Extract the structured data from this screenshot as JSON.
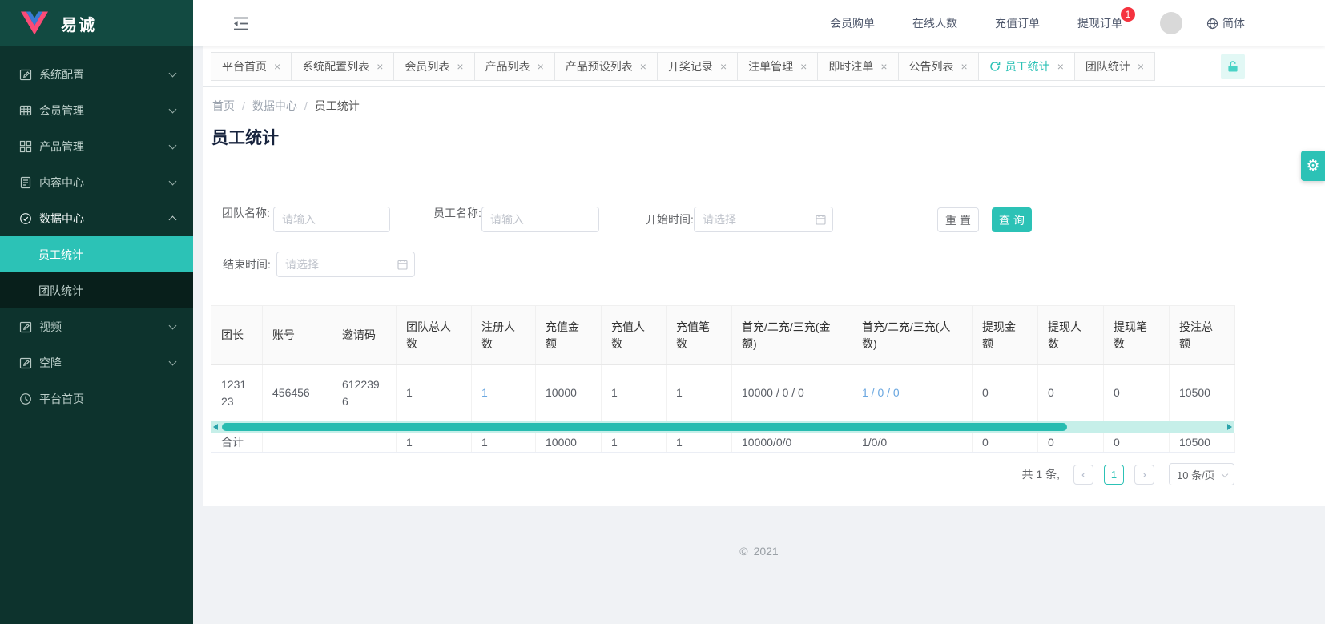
{
  "brand": {
    "name": "易诚"
  },
  "colors": {
    "accent": "#2cc2b6",
    "badge_red": "#f5333f",
    "link_blue": "#6aa7e0",
    "sidebar_bg": "#0d332d"
  },
  "sidebar": {
    "items": [
      {
        "label": "系统配置",
        "icon": "edit-icon"
      },
      {
        "label": "会员管理",
        "icon": "table-icon"
      },
      {
        "label": "产品管理",
        "icon": "grid-icon"
      },
      {
        "label": "内容中心",
        "icon": "document-icon"
      },
      {
        "label": "数据中心",
        "icon": "check-circle-icon",
        "children": [
          {
            "label": "员工统计",
            "active": true
          },
          {
            "label": "团队统计"
          }
        ]
      },
      {
        "label": "视频",
        "icon": "edit-icon"
      },
      {
        "label": "空降",
        "icon": "edit-icon"
      },
      {
        "label": "平台首页",
        "icon": "dashboard-icon"
      }
    ]
  },
  "topbar": {
    "menu": [
      {
        "label": "会员购单"
      },
      {
        "label": "在线人数"
      },
      {
        "label": "充值订单"
      },
      {
        "label": "提现订单",
        "badge": "1"
      }
    ],
    "language": "简体"
  },
  "tabs": {
    "close_symbol": "×",
    "items": [
      {
        "label": "平台首页"
      },
      {
        "label": "系统配置列表"
      },
      {
        "label": "会员列表"
      },
      {
        "label": "产品列表"
      },
      {
        "label": "产品预设列表"
      },
      {
        "label": "开奖记录"
      },
      {
        "label": "注单管理"
      },
      {
        "label": "即时注单"
      },
      {
        "label": "公告列表"
      },
      {
        "label": "员工统计",
        "active": true
      },
      {
        "label": "团队统计"
      }
    ]
  },
  "breadcrumb": {
    "separator": "/",
    "items": [
      {
        "label": "首页"
      },
      {
        "label": "数据中心"
      },
      {
        "label": "员工统计"
      }
    ]
  },
  "page": {
    "title": "员工统计"
  },
  "filters": {
    "team_name": {
      "label": "团队名称:",
      "placeholder": "请输入",
      "value": ""
    },
    "staff_name": {
      "label": "员工名称:",
      "placeholder": "请输入",
      "value": ""
    },
    "start_time": {
      "label": "开始时间:",
      "placeholder": "请选择",
      "value": ""
    },
    "end_time": {
      "label": "结束时间:",
      "placeholder": "请选择",
      "value": ""
    },
    "reset_label": "重 置",
    "query_label": "查 询"
  },
  "table": {
    "headers": [
      "团长",
      "账号",
      "邀请码",
      "团队总人数",
      "注册人数",
      "充值金额",
      "充值人数",
      "充值笔数",
      "首充/二充/三充(金额)",
      "首充/二充/三充(人数)",
      "提现金额",
      "提现人数",
      "提现笔数",
      "投注总额"
    ],
    "rows": [
      [
        "123123",
        "456456",
        "6122396",
        "1",
        "1",
        "10000",
        "1",
        "1",
        "10000 / 0 / 0",
        "1 / 0 / 0",
        "0",
        "0",
        "0",
        "10500"
      ]
    ],
    "summary": [
      "合计",
      "",
      "",
      "1",
      "1",
      "10000",
      "1",
      "1",
      "10000/0/0",
      "1/0/0",
      "0",
      "0",
      "0",
      "10500"
    ]
  },
  "pagination": {
    "total_text": "共 1 条,",
    "prev_symbol": "‹",
    "current_page": "1",
    "next_symbol": "›",
    "page_size": "10 条/页"
  },
  "footer": {
    "copyright_symbol": "©",
    "year": "2021"
  },
  "icons": {
    "gear": "⚙"
  }
}
